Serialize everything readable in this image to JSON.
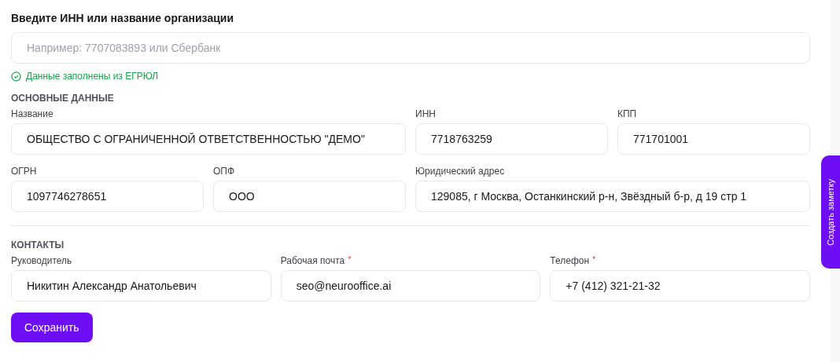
{
  "search": {
    "label": "Введите ИНН или название организации",
    "placeholder": "Например: 7707083893 или Сбербанк"
  },
  "status": {
    "kind": "success",
    "text": "Данные заполнены из ЕГРЮЛ"
  },
  "main_section": {
    "title": "ОСНОВНЫЕ ДАННЫЕ",
    "fields": [
      {
        "label": "Название",
        "value": "ОБЩЕСТВО С ОГРАНИЧЕННОЙ ОТВЕТСТВЕННОСТЬЮ \"ДЕМО\""
      },
      {
        "label": "ИНН",
        "value": "7718763259"
      },
      {
        "label": "КПП",
        "value": "771701001"
      },
      {
        "label": "ОГРН",
        "value": "1097746278651"
      },
      {
        "label": "ОПФ",
        "value": "ООО"
      },
      {
        "label": "Юридический адрес",
        "value": "129085, г Москва, Останкинский р-н, Звёздный б-р, д 19 стр 1"
      }
    ]
  },
  "contacts_section": {
    "title": "КОНТАКТЫ",
    "fields": [
      {
        "label": "Руководитель",
        "value": "Никитин Александр Анатольевич"
      },
      {
        "label": "Рабочая почта",
        "required_mark": "*",
        "value": "seo@neurooffice.ai"
      },
      {
        "label": "Телефон",
        "required_mark": "*",
        "value": "+7 (412) 321-21-32"
      }
    ]
  },
  "save_button": "Сохранить",
  "side_tab": "Создать заметку"
}
